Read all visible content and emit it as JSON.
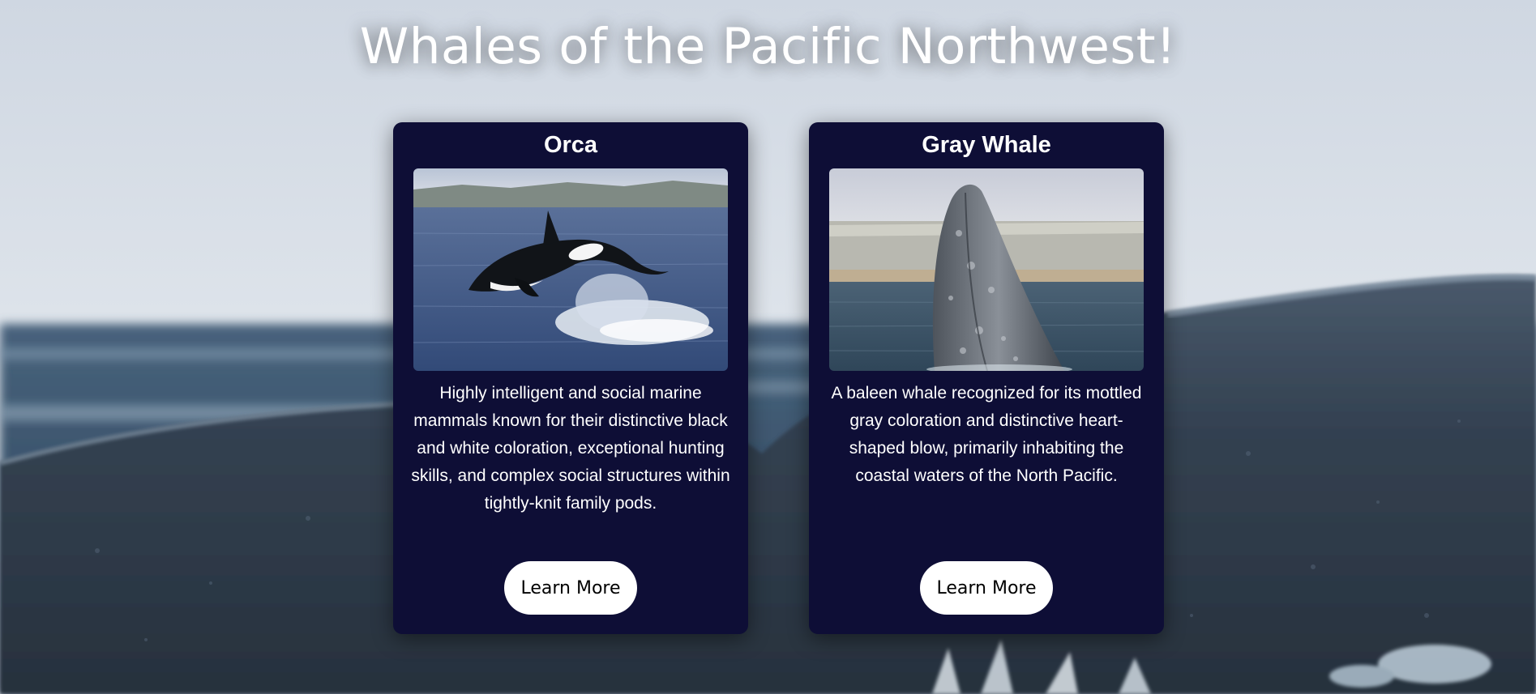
{
  "page": {
    "title": "Whales of the Pacific Northwest!"
  },
  "cards": [
    {
      "title": "Orca",
      "image_subject": "orca breaching from the ocean",
      "description": "Highly intelligent and social marine mammals known for their distinctive black and white coloration, exceptional hunting skills, and complex social structures within tightly-knit family pods.",
      "button_label": "Learn More"
    },
    {
      "title": "Gray Whale",
      "image_subject": "gray whale spyhopping near a coastline",
      "description": "A baleen whale recognized for its mottled gray coloration and distinctive heart-shaped blow, primarily inhabiting the coastal waters of the North Pacific.",
      "button_label": "Learn More"
    }
  ],
  "colors": {
    "card_background": "#0e0e36",
    "button_background": "#ffffff",
    "title_text": "#ffffff"
  }
}
